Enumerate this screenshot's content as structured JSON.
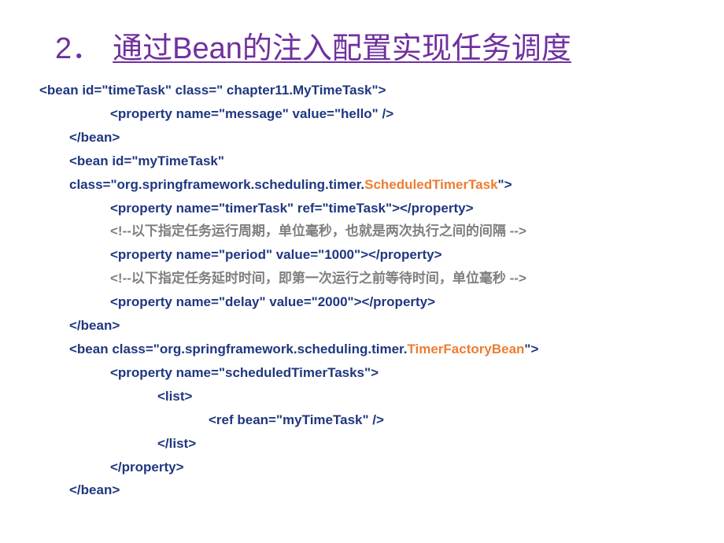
{
  "title": {
    "number": "2．",
    "text": "通过Bean的注入配置实现任务调度"
  },
  "code": {
    "line1_a": "<bean id=\"timeTask\" class=\" chapter11.MyTimeTask\">",
    "line2": "<property name=\"message\" value=\"hello\" />",
    "line3": "</bean>",
    "line4": "<bean id=\"myTimeTask\"",
    "line5_a": "class=\"org.springframework.scheduling.timer.",
    "line5_b": "ScheduledTimerTask",
    "line5_c": "\">",
    "line6": "<property name=\"timerTask\" ref=\"timeTask\"></property>",
    "line7": "<!--以下指定任务运行周期，单位毫秒，也就是两次执行之间的间隔 -->",
    "line8": "<property name=\"period\" value=\"1000\"></property>",
    "line9": "<!--以下指定任务延时时间，即第一次运行之前等待时间，单位毫秒 -->",
    "line10": "<property name=\"delay\" value=\"2000\"></property>",
    "line11": "</bean>",
    "line12_a": "<bean class=\"org.springframework.scheduling.timer.",
    "line12_b": "TimerFactoryBean",
    "line12_c": "\">",
    "line13": "<property name=\"scheduledTimerTasks\">",
    "line14": "<list>",
    "line15": "<ref bean=\"myTimeTask\" />",
    "line16": "</list>",
    "line17": "</property>",
    "line18": "</bean>"
  }
}
